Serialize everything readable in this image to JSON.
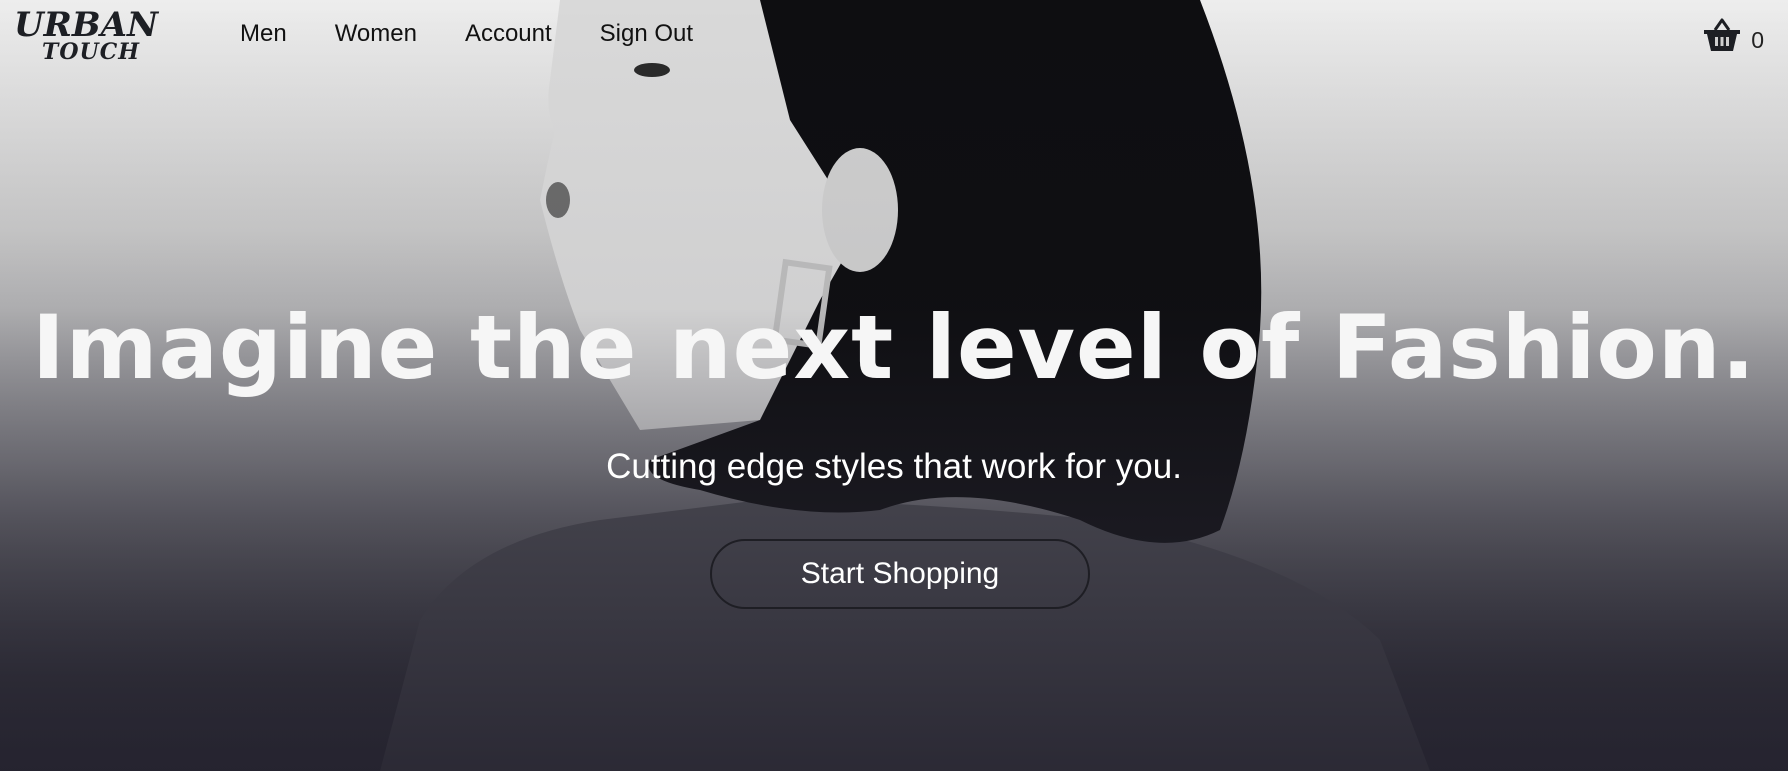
{
  "brand": {
    "line1": "URBAN",
    "line2": "TOUCH"
  },
  "nav": {
    "items": [
      {
        "label": "Men"
      },
      {
        "label": "Women"
      },
      {
        "label": "Account"
      },
      {
        "label": "Sign Out"
      }
    ]
  },
  "cart": {
    "icon": "basket-icon",
    "count": "0"
  },
  "hero": {
    "headline": "Imagine the next level of Fashion.",
    "subheadline": "Cutting edge styles that work for you.",
    "cta_label": "Start Shopping",
    "image": "hero-photo-woman-profile"
  },
  "colors": {
    "headline": "#f6f6f6",
    "text_dark": "#111111",
    "button_border": "#1e1e24",
    "overlay_bottom": "#2c2b36"
  }
}
